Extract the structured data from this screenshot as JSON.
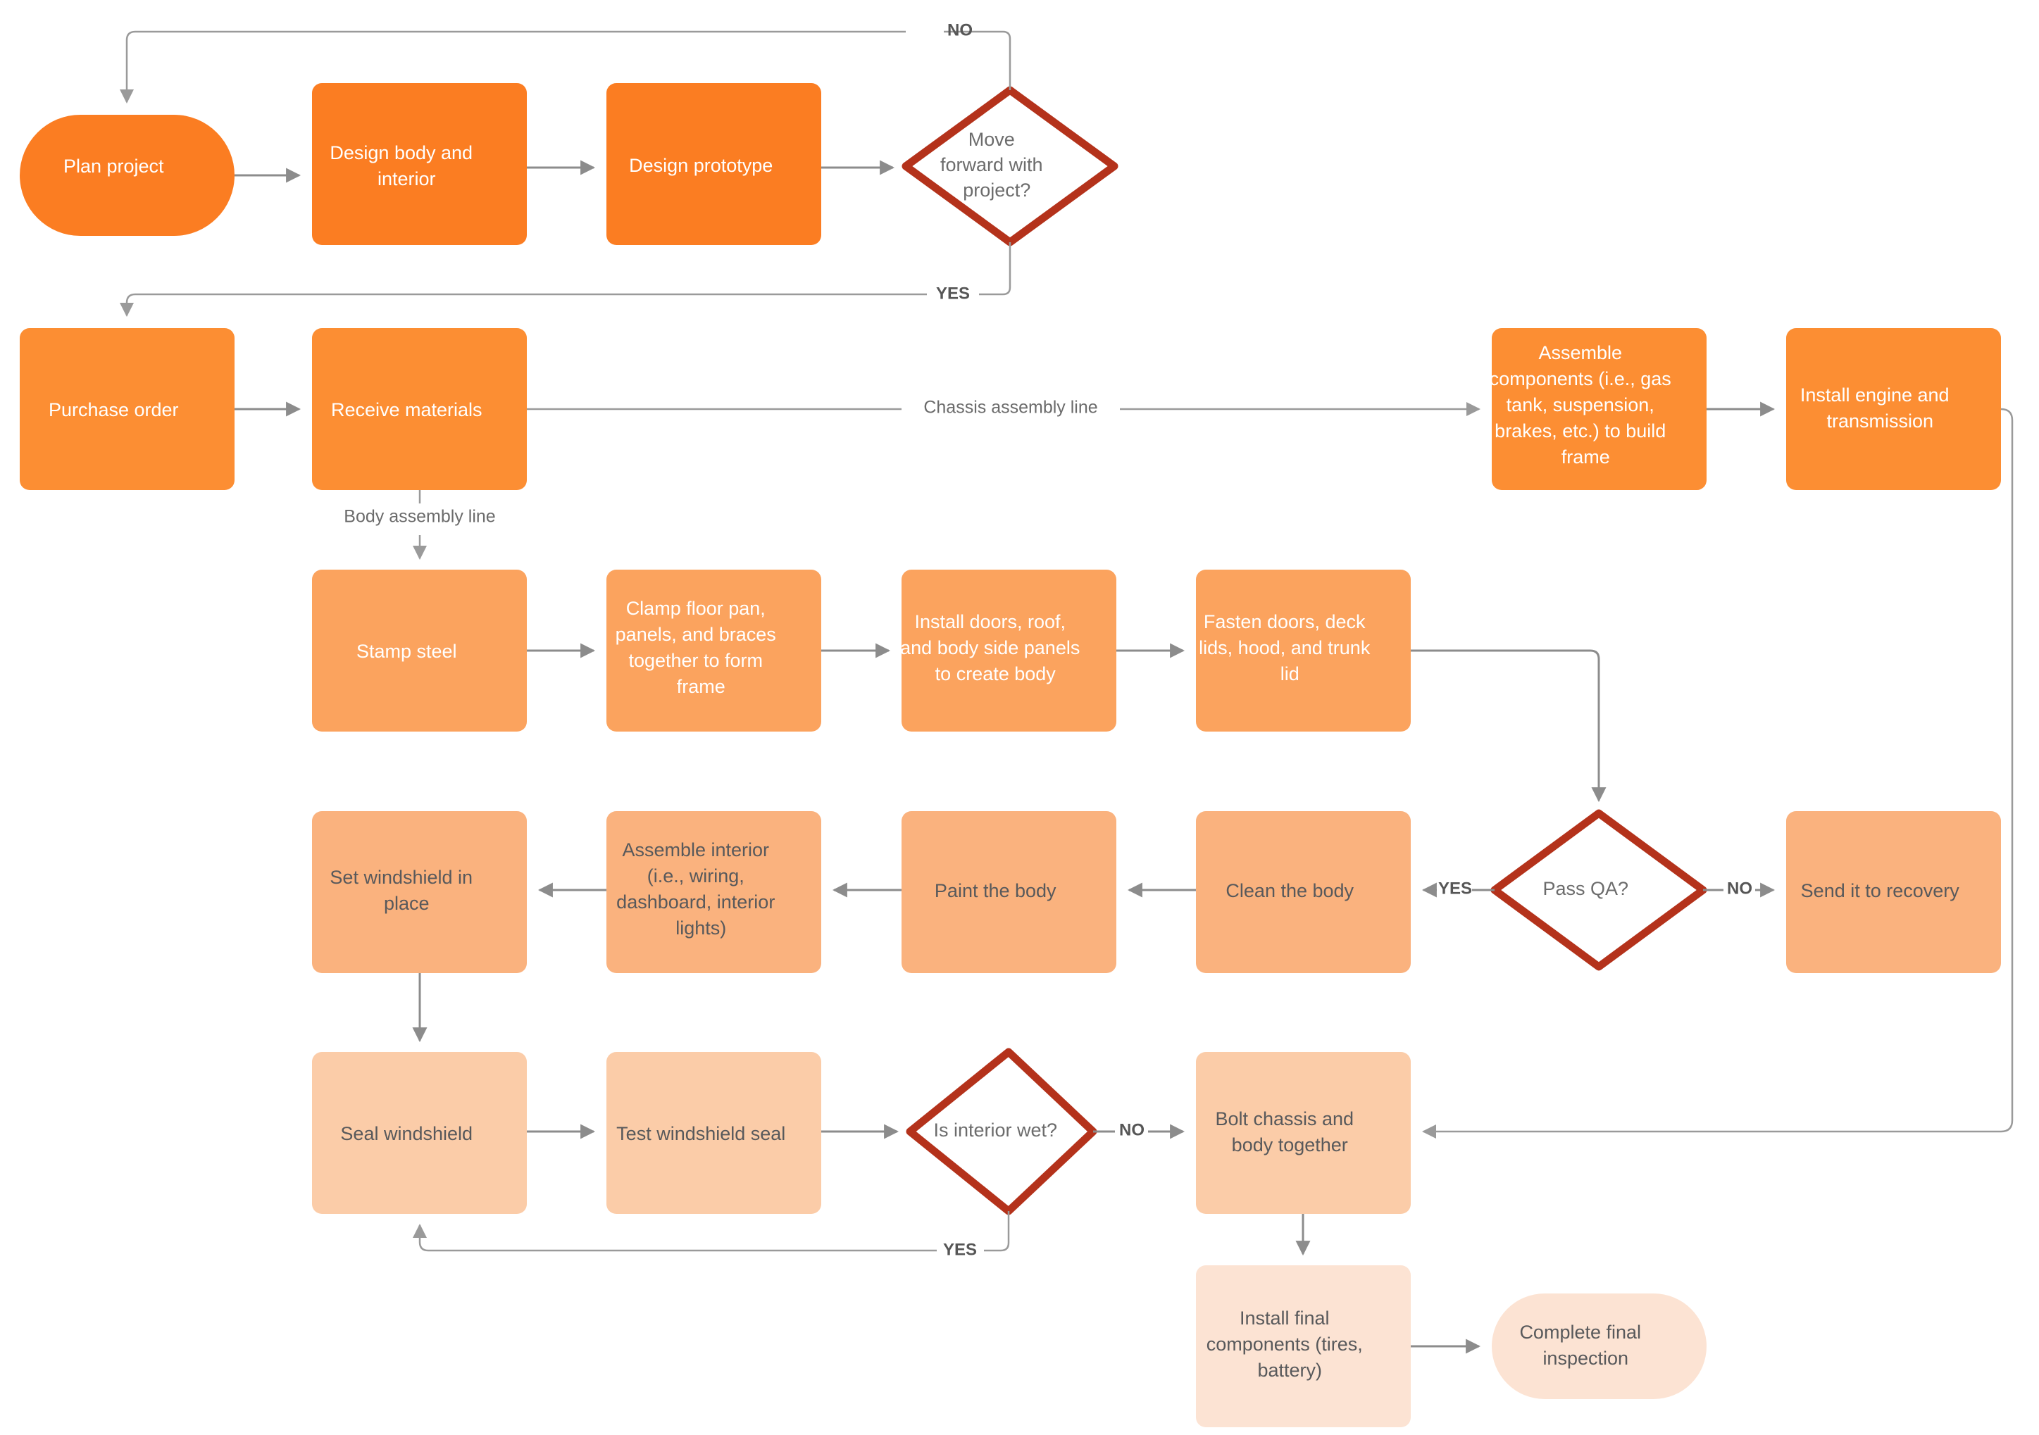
{
  "diagram": {
    "title": "Car Manufacturing Process Flowchart",
    "palette": {
      "tier1": "#fb7d22",
      "tier2": "#fc8e33",
      "tier3": "#fba35e",
      "tier4": "#fab27e",
      "tier5": "#fbcca8",
      "tier6": "#fce3d3",
      "decision_stroke": "#b4321b",
      "decision_fill": "#ffffff",
      "connector": "#8c8c8c",
      "text_light": "#ffffff",
      "text_dark": "#58595b"
    },
    "nodes": [
      {
        "id": "plan-project",
        "label": "Plan project",
        "shape": "stadium",
        "tier": 1
      },
      {
        "id": "design-body",
        "label": "Design body and interior",
        "shape": "rect",
        "tier": 1
      },
      {
        "id": "design-prototype",
        "label": "Design prototype",
        "shape": "rect",
        "tier": 1
      },
      {
        "id": "move-forward",
        "label": "Move forward with project?",
        "shape": "diamond",
        "tier": 0
      },
      {
        "id": "purchase-order",
        "label": "Purchase order",
        "shape": "rect",
        "tier": 2
      },
      {
        "id": "receive-materials",
        "label": "Receive materials",
        "shape": "rect",
        "tier": 2
      },
      {
        "id": "assemble-components",
        "label": "Assemble components (i.e., gas tank, suspension, brakes, etc.) to build frame",
        "shape": "rect",
        "tier": 2
      },
      {
        "id": "install-engine",
        "label": "Install engine and transmission",
        "shape": "rect",
        "tier": 2
      },
      {
        "id": "stamp-steel",
        "label": "Stamp steel",
        "shape": "rect",
        "tier": 3
      },
      {
        "id": "clamp-floor-pan",
        "label": "Clamp floor pan, panels, and braces together to form frame",
        "shape": "rect",
        "tier": 3
      },
      {
        "id": "install-doors",
        "label": "Install doors, roof, and body side panels to create body",
        "shape": "rect",
        "tier": 3
      },
      {
        "id": "fasten-doors",
        "label": "Fasten doors, deck lids, hood, and trunk lid",
        "shape": "rect",
        "tier": 3
      },
      {
        "id": "pass-qa",
        "label": "Pass QA?",
        "shape": "diamond",
        "tier": 0
      },
      {
        "id": "send-to-recovery",
        "label": "Send it to recovery",
        "shape": "rect",
        "tier": 4
      },
      {
        "id": "clean-the-body",
        "label": "Clean the body",
        "shape": "rect",
        "tier": 4
      },
      {
        "id": "paint-the-body",
        "label": "Paint the body",
        "shape": "rect",
        "tier": 4
      },
      {
        "id": "assemble-interior",
        "label": "Assemble interior (i.e., wiring, dashboard, interior lights)",
        "shape": "rect",
        "tier": 4
      },
      {
        "id": "set-windshield",
        "label": "Set windshield in place",
        "shape": "rect",
        "tier": 4
      },
      {
        "id": "seal-windshield",
        "label": "Seal windshield",
        "shape": "rect",
        "tier": 5
      },
      {
        "id": "test-windshield-seal",
        "label": "Test windshield seal",
        "shape": "rect",
        "tier": 5
      },
      {
        "id": "interior-wet",
        "label": "Is interior wet?",
        "shape": "diamond",
        "tier": 0
      },
      {
        "id": "bolt-chassis",
        "label": "Bolt chassis and body together",
        "shape": "rect",
        "tier": 5
      },
      {
        "id": "install-final",
        "label": "Install final components (tires, battery)",
        "shape": "rect",
        "tier": 6
      },
      {
        "id": "complete-inspection",
        "label": "Complete final inspection",
        "shape": "stadium",
        "tier": 6
      }
    ],
    "edge_labels": {
      "no_project": "NO",
      "yes_project": "YES",
      "chassis_line": "Chassis assembly line",
      "body_line": "Body assembly line",
      "qa_yes": "YES",
      "qa_no": "NO",
      "wet_no": "NO",
      "wet_yes": "YES"
    },
    "node_text_lines": {
      "plan-project": [
        "Plan project"
      ],
      "design-body": [
        "Design body and",
        "interior"
      ],
      "design-prototype": [
        "Design prototype"
      ],
      "move-forward": [
        "Move",
        "forward with",
        "project?"
      ],
      "purchase-order": [
        "Purchase order"
      ],
      "receive-materials": [
        "Receive materials"
      ],
      "assemble-components": [
        "Assemble",
        "components (i.e., gas",
        "tank, suspension,",
        "brakes, etc.) to build",
        "frame"
      ],
      "install-engine": [
        "Install engine and",
        "transmission"
      ],
      "stamp-steel": [
        "Stamp steel"
      ],
      "clamp-floor-pan": [
        "Clamp floor pan,",
        "panels, and braces",
        "together to form",
        "frame"
      ],
      "install-doors": [
        "Install doors, roof,",
        "and body side panels",
        "to create body"
      ],
      "fasten-doors": [
        "Fasten doors, deck",
        "lids, hood, and trunk",
        "lid"
      ],
      "pass-qa": [
        "Pass QA?"
      ],
      "send-to-recovery": [
        "Send it to recovery"
      ],
      "clean-the-body": [
        "Clean the body"
      ],
      "paint-the-body": [
        "Paint the body"
      ],
      "assemble-interior": [
        "Assemble interior",
        "(i.e., wiring,",
        "dashboard, interior",
        "lights)"
      ],
      "set-windshield": [
        "Set windshield in",
        "place"
      ],
      "seal-windshield": [
        "Seal windshield"
      ],
      "test-windshield-seal": [
        "Test windshield seal"
      ],
      "interior-wet": [
        "Is interior wet?"
      ],
      "bolt-chassis": [
        "Bolt chassis and",
        "body together"
      ],
      "install-final": [
        "Install final",
        "components (tires,",
        "battery)"
      ],
      "complete-inspection": [
        "Complete final",
        "inspection"
      ]
    }
  }
}
